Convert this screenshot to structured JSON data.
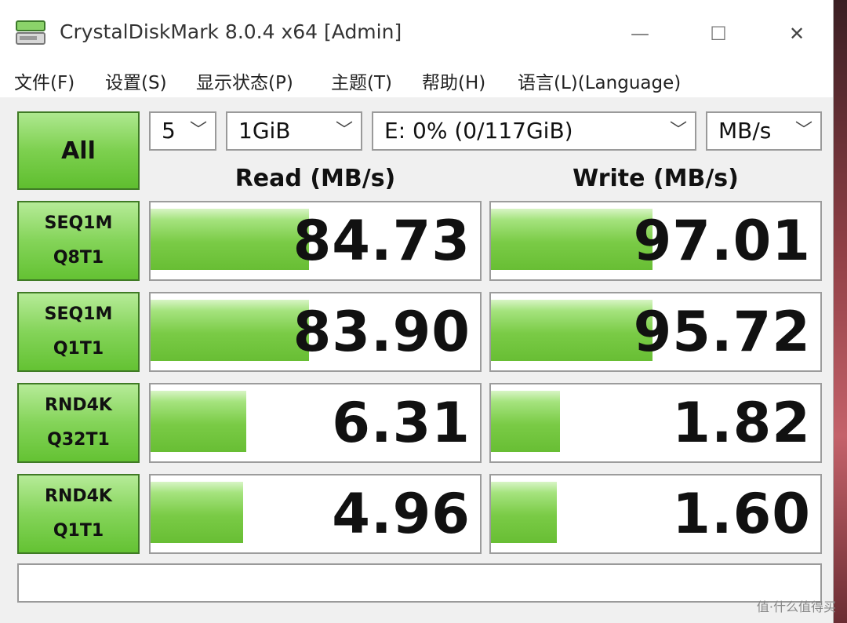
{
  "window": {
    "title": "CrystalDiskMark 8.0.4 x64 [Admin]",
    "minimize_glyph": "—",
    "maximize_glyph": "☐",
    "close_glyph": "✕"
  },
  "menu": [
    "文件(F)",
    "设置(S)",
    "显示状态(P)",
    "主题(T)",
    "帮助(H)",
    "语言(L)(Language)"
  ],
  "controls": {
    "all_label": "All",
    "count": "5",
    "size": "1GiB",
    "drive": "E: 0% (0/117GiB)",
    "unit": "MB/s",
    "chevron": "﹀"
  },
  "headers": {
    "read": "Read (MB/s)",
    "write": "Write (MB/s)"
  },
  "tests": [
    {
      "line1": "SEQ1M",
      "line2": "Q8T1",
      "read": "84.73",
      "write": "97.01",
      "read_fill": 0.48,
      "write_fill": 0.49
    },
    {
      "line1": "SEQ1M",
      "line2": "Q1T1",
      "read": "83.90",
      "write": "95.72",
      "read_fill": 0.48,
      "write_fill": 0.49
    },
    {
      "line1": "RND4K",
      "line2": "Q32T1",
      "read": "6.31",
      "write": "1.82",
      "read_fill": 0.29,
      "write_fill": 0.21
    },
    {
      "line1": "RND4K",
      "line2": "Q1T1",
      "read": "4.96",
      "write": "1.60",
      "read_fill": 0.28,
      "write_fill": 0.2
    }
  ],
  "comment": "",
  "watermark": "值·什么值得买",
  "colors": {
    "accent_green": "#7acb46",
    "button_border": "#3f7a25"
  }
}
